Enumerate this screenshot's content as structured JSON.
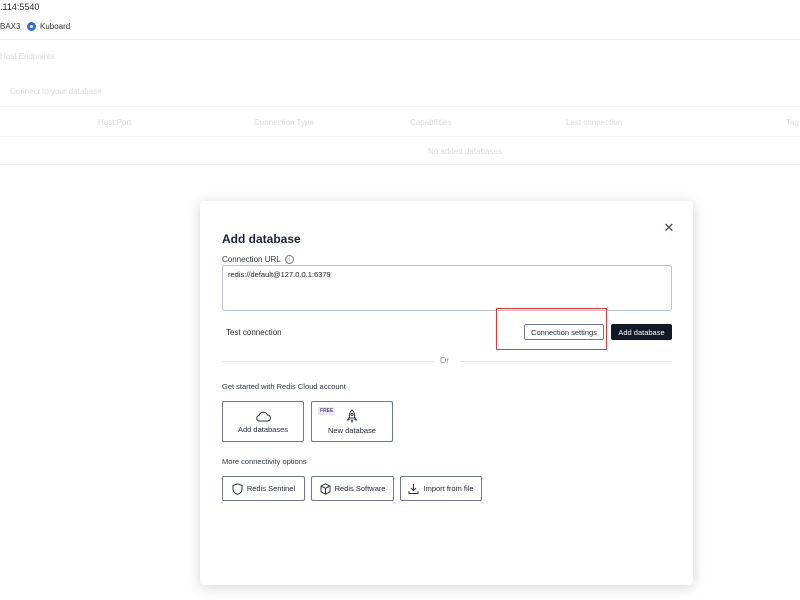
{
  "browser": {
    "address": ".114:5540",
    "bookmarks": [
      {
        "label": "BAX3"
      },
      {
        "label": "Kuboard"
      }
    ]
  },
  "background": {
    "faint_texts": [
      "Host Endpoints",
      "Connect to your database",
      "Host:Port",
      "Connection Type",
      "Capabilities",
      "Last connection",
      "Tag",
      "No added databases"
    ]
  },
  "modal": {
    "title": "Add database",
    "url_label": "Connection URL",
    "url_value": "redis://default@127.0.0.1:6379",
    "test_connection": "Test connection",
    "connection_settings": "Connection settings",
    "add_database": "Add database",
    "or": "Or",
    "cloud_label": "Get started with Redis Cloud account",
    "cloud_cards": [
      {
        "label": "Add databases",
        "icon": "cloud-icon"
      },
      {
        "label": "New database",
        "icon": "rocket-icon",
        "tag": "FREE"
      }
    ],
    "more_label": "More connectivity options",
    "options": [
      {
        "label": "Redis Sentinel",
        "icon": "shield-icon"
      },
      {
        "label": "Redis Software",
        "icon": "box-icon"
      },
      {
        "label": "Import from file",
        "icon": "download-icon"
      }
    ]
  },
  "colors": {
    "primary_button": "#111827",
    "highlight": "#e23b3b"
  }
}
